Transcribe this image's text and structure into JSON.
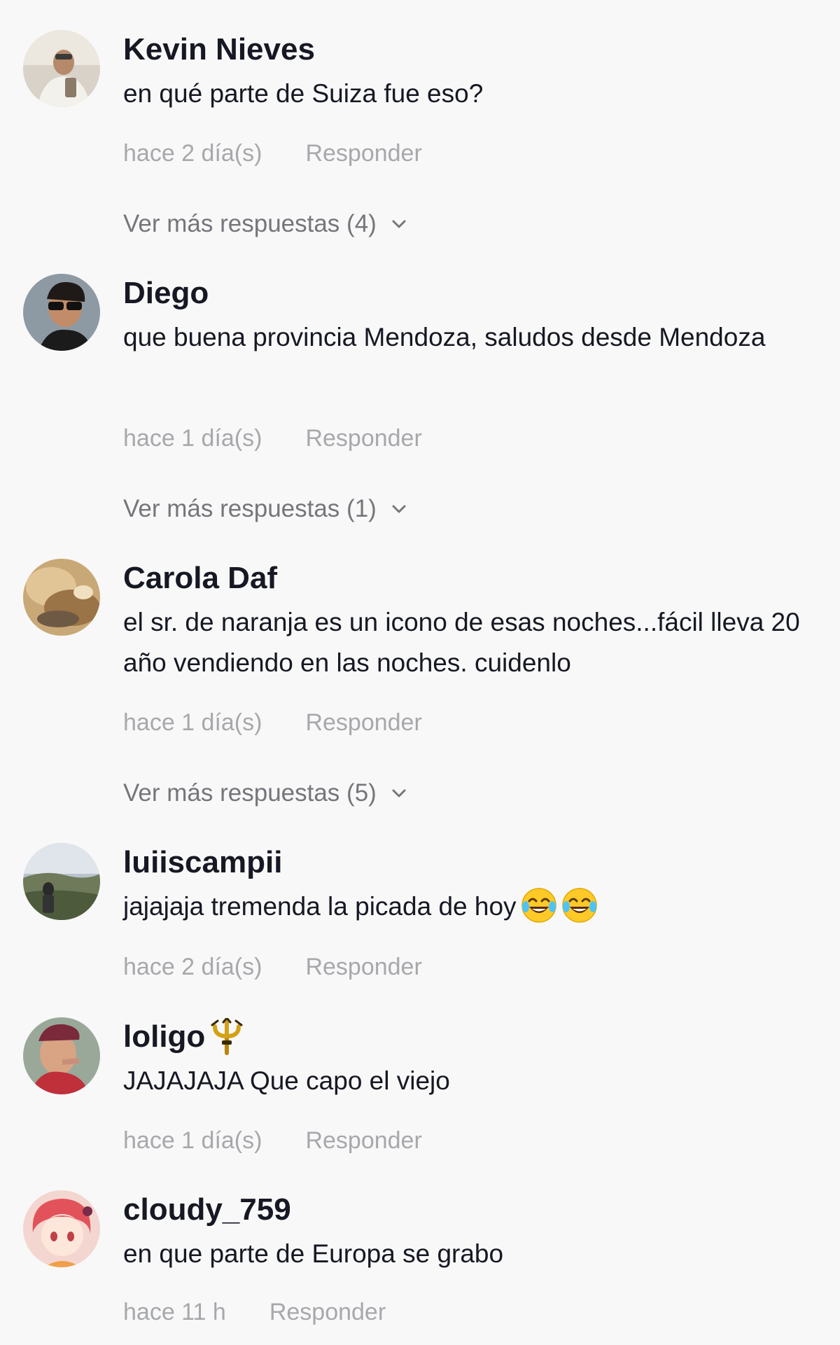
{
  "comments": [
    {
      "username": "Kevin Nieves",
      "text": "en qué parte de Suiza fue eso?",
      "time": "hace 2 día(s)",
      "reply_label": "Responder",
      "more_replies": "Ver más respuestas (4)"
    },
    {
      "username": "Diego",
      "text": "que buena provincia Mendoza, saludos desde Mendoza",
      "time": "hace 1 día(s)",
      "reply_label": "Responder",
      "more_replies": "Ver más respuestas (1)"
    },
    {
      "username": "Carola Daf",
      "text": "el sr. de naranja es un icono de esas noches...fácil lleva 20 año vendiendo en las noches. cuidenlo",
      "time": "hace 1 día(s)",
      "reply_label": "Responder",
      "more_replies": "Ver más respuestas (5)"
    },
    {
      "username": "luiiscampii",
      "text": "jajajaja tremenda la picada de hoy",
      "emoji": [
        "face-with-tears-of-joy-icon",
        "face-with-tears-of-joy-icon"
      ],
      "time": "hace 2 día(s)",
      "reply_label": "Responder"
    },
    {
      "username": "loligo",
      "badge_icon": "trident-emoji-icon",
      "text": "JAJAJAJA Que capo el viejo",
      "time": "hace 1 día(s)",
      "reply_label": "Responder"
    },
    {
      "username": "cloudy_759",
      "text": "en que parte de Europa se grabo",
      "time": "hace 11 h",
      "reply_label": "Responder"
    }
  ],
  "icons": {
    "expand": "chevron-down-icon"
  },
  "colors": {
    "background": "#f8f8f8",
    "username": "#161823",
    "text": "#161823",
    "meta": "#a7a8ac",
    "more_replies": "#75767b"
  }
}
